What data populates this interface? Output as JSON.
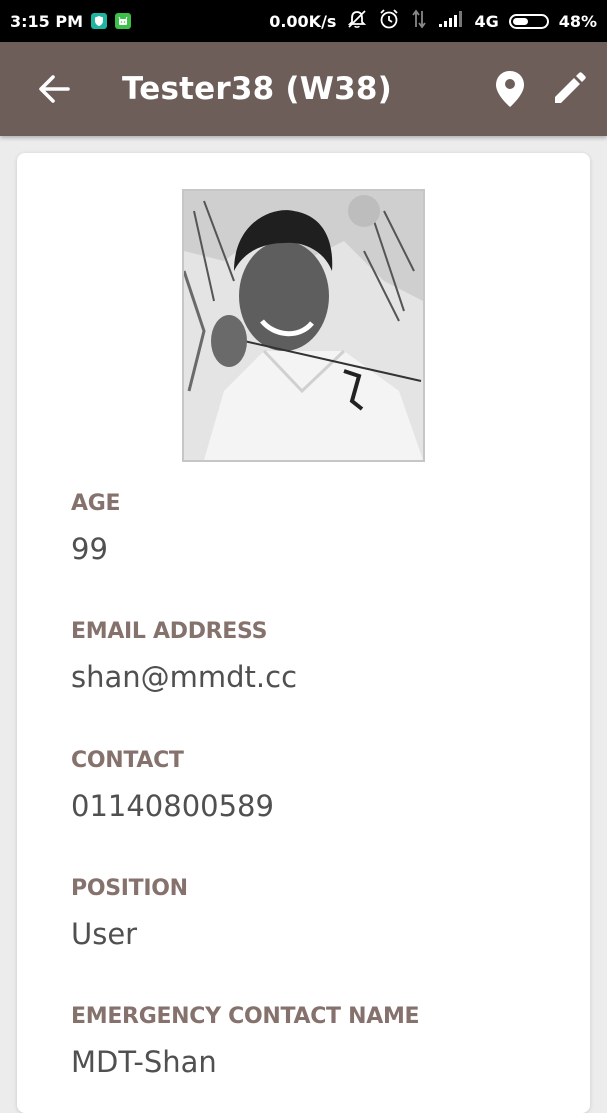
{
  "status_bar": {
    "time": "3:15 PM",
    "net_speed": "0.00K/s",
    "network": "4G",
    "battery": "48%",
    "battery_level": 0.48
  },
  "app_bar": {
    "title": "Tester38 (W38)",
    "back_icon": "arrow-left-icon",
    "location_icon": "map-pin-icon",
    "edit_icon": "pencil-icon",
    "color": "#6d5e5a"
  },
  "profile": {
    "photo_icon": "user-photo",
    "fields": [
      {
        "label": "AGE",
        "value": "99"
      },
      {
        "label": "EMAIL ADDRESS",
        "value": "shan@mmdt.cc"
      },
      {
        "label": "CONTACT",
        "value": "01140800589"
      },
      {
        "label": "POSITION",
        "value": "User"
      },
      {
        "label": "EMERGENCY CONTACT NAME",
        "value": "MDT-Shan"
      }
    ],
    "label_color": "#85726d"
  }
}
